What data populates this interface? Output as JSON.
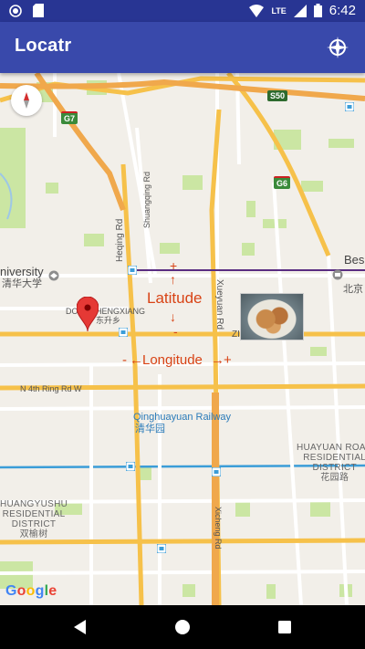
{
  "status_bar": {
    "time": "6:42",
    "network": "LTE",
    "icons": [
      "notification-circle-icon",
      "sd-card-icon",
      "wifi-icon",
      "lte-signal-icon",
      "battery-icon"
    ]
  },
  "app_bar": {
    "title": "Locatr",
    "action_icon": "locate-crosshair-icon",
    "color": "#3949ab",
    "status_color": "#283593"
  },
  "map": {
    "roads": {
      "heqing": "Heqing Rd",
      "shuangqing": "Shuangqing Rd",
      "xueyuan": "Xueyuan Rd",
      "xicheng": "Xicheng Rd",
      "north_4th_ring": "N 4th Ring Rd W"
    },
    "shields": [
      "G7",
      "S50",
      "G6"
    ],
    "places": {
      "university": "niversity",
      "university_cn": "清华大学",
      "dongshengxiang": "DONGSHENGXIANG",
      "dongshengxiang_cn": "东升乡",
      "zi": "ZI",
      "bes": "Bes",
      "bes_cn": "北京",
      "railway": "Qinghuayuan Railway",
      "railway_cn": "清华园",
      "huayuan_l1": "HUAYUAN ROAD",
      "huayuan_l2": "RESIDENTIAL",
      "huayuan_l3": "DISTRICT",
      "huayuan_cn": "花园路",
      "huangyushu_l1": "HUANGYUSHU",
      "huangyushu_l2": "RESIDENTIAL",
      "huangyushu_l3": "DISTRICT",
      "huangyushu_cn": "双榆树"
    },
    "overlay": {
      "latitude_label": "Latitude",
      "longitude_label": "Longitude",
      "plus": "+",
      "minus": "-",
      "arrow_up": "↑",
      "arrow_down": "↓",
      "arrow_left": "←",
      "arrow_right": "→"
    },
    "google_logo": [
      "G",
      "o",
      "o",
      "g",
      "l",
      "e"
    ],
    "compass_icon": "compass-icon",
    "marker_icon": "map-pin-icon"
  },
  "nav_bar": {
    "back_icon": "back-triangle-icon",
    "home_icon": "home-circle-icon",
    "recents_icon": "recents-square-icon"
  }
}
